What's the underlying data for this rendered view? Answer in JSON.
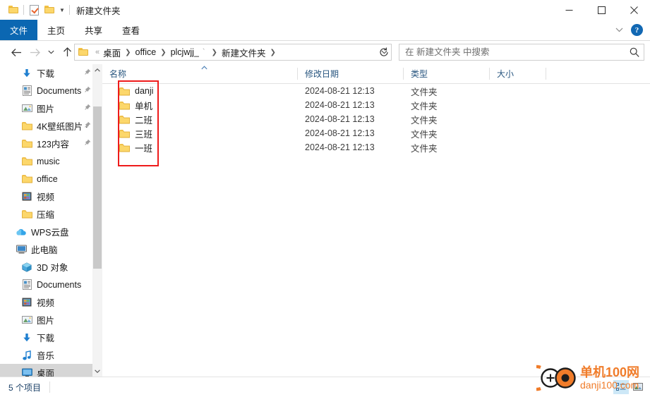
{
  "window": {
    "title": "新建文件夹",
    "quick_access": [
      {
        "name": "folder-icon",
        "label": "文件夹"
      },
      {
        "name": "properties-icon",
        "label": "属性"
      },
      {
        "name": "new-folder-icon",
        "label": "新建文件夹"
      }
    ],
    "controls": {
      "minimize": "最小化",
      "maximize": "最大化",
      "close": "关闭"
    }
  },
  "ribbon": {
    "tabs": [
      {
        "label": "文件",
        "active": true
      },
      {
        "label": "主页",
        "active": false
      },
      {
        "label": "共享",
        "active": false
      },
      {
        "label": "查看",
        "active": false
      }
    ],
    "expand_label": "展开功能区",
    "help_label": "?"
  },
  "navigation": {
    "back": "后退",
    "forward": "前进",
    "recent": "最近浏览的位置",
    "up": "上移到",
    "refresh": "刷新",
    "breadcrumbs": [
      {
        "label": "桌面"
      },
      {
        "label": "office"
      },
      {
        "label": "plcjwjj_"
      },
      {
        "label": "新建文件夹"
      }
    ],
    "overflow_marker": "«"
  },
  "search": {
    "placeholder": "在 新建文件夹 中搜索",
    "value": ""
  },
  "sidebar": {
    "items": [
      {
        "label": "下载",
        "icon": "download-icon",
        "pinned": true,
        "indent": 1,
        "selected": false
      },
      {
        "label": "Documents",
        "icon": "documents-icon",
        "pinned": true,
        "indent": 1,
        "selected": false
      },
      {
        "label": "图片",
        "icon": "pictures-icon",
        "pinned": true,
        "indent": 1,
        "selected": false
      },
      {
        "label": "4K壁纸图片 ·",
        "icon": "folder-icon",
        "pinned": true,
        "indent": 1,
        "selected": false
      },
      {
        "label": "123内容",
        "icon": "folder-icon",
        "pinned": true,
        "indent": 1,
        "selected": false
      },
      {
        "label": "music",
        "icon": "folder-icon",
        "pinned": false,
        "indent": 1,
        "selected": false
      },
      {
        "label": "office",
        "icon": "folder-icon",
        "pinned": false,
        "indent": 1,
        "selected": false
      },
      {
        "label": "视频",
        "icon": "videos-icon",
        "pinned": false,
        "indent": 1,
        "selected": false
      },
      {
        "label": "压缩",
        "icon": "folder-icon",
        "pinned": false,
        "indent": 1,
        "selected": false
      },
      {
        "label": "WPS云盘",
        "icon": "cloud-icon",
        "pinned": false,
        "indent": 0,
        "selected": false
      },
      {
        "label": "此电脑",
        "icon": "computer-icon",
        "pinned": false,
        "indent": 0,
        "selected": false
      },
      {
        "label": "3D 对象",
        "icon": "3d-objects-icon",
        "pinned": false,
        "indent": 1,
        "selected": false
      },
      {
        "label": "Documents",
        "icon": "documents-icon",
        "pinned": false,
        "indent": 1,
        "selected": false
      },
      {
        "label": "视频",
        "icon": "videos-icon",
        "pinned": false,
        "indent": 1,
        "selected": false
      },
      {
        "label": "图片",
        "icon": "pictures-icon",
        "pinned": false,
        "indent": 1,
        "selected": false
      },
      {
        "label": "下载",
        "icon": "download-icon",
        "pinned": false,
        "indent": 1,
        "selected": false
      },
      {
        "label": "音乐",
        "icon": "music-icon",
        "pinned": false,
        "indent": 1,
        "selected": false
      },
      {
        "label": "桌面",
        "icon": "desktop-icon",
        "pinned": false,
        "indent": 1,
        "selected": true
      }
    ],
    "scroll_up": "向上滚动",
    "scroll_down": "向下滚动"
  },
  "filelist": {
    "columns": [
      {
        "label": "名称",
        "sorted": "asc"
      },
      {
        "label": "修改日期",
        "sorted": ""
      },
      {
        "label": "类型",
        "sorted": ""
      },
      {
        "label": "大小",
        "sorted": ""
      }
    ],
    "rows": [
      {
        "name": "danji",
        "modified": "2024-08-21 12:13",
        "type": "文件夹",
        "size": ""
      },
      {
        "name": "单机",
        "modified": "2024-08-21 12:13",
        "type": "文件夹",
        "size": ""
      },
      {
        "name": "二班",
        "modified": "2024-08-21 12:13",
        "type": "文件夹",
        "size": ""
      },
      {
        "name": "三班",
        "modified": "2024-08-21 12:13",
        "type": "文件夹",
        "size": ""
      },
      {
        "name": "一班",
        "modified": "2024-08-21 12:13",
        "type": "文件夹",
        "size": ""
      }
    ],
    "annotation": {
      "color": "#ee1b1b",
      "shape": "rectangle"
    }
  },
  "statusbar": {
    "item_count": "5 个项目",
    "view_details": "详细信息",
    "view_large_icons": "大图标"
  },
  "watermark": {
    "chinese": "单机100网",
    "english": "danji100.com",
    "color": "#f07c2a"
  },
  "colors": {
    "accent": "#0b67b2",
    "folder": "#fcd76b",
    "annotation": "#ee1b1b",
    "watermark": "#f07c2a",
    "column_header_text": "#27557f"
  }
}
